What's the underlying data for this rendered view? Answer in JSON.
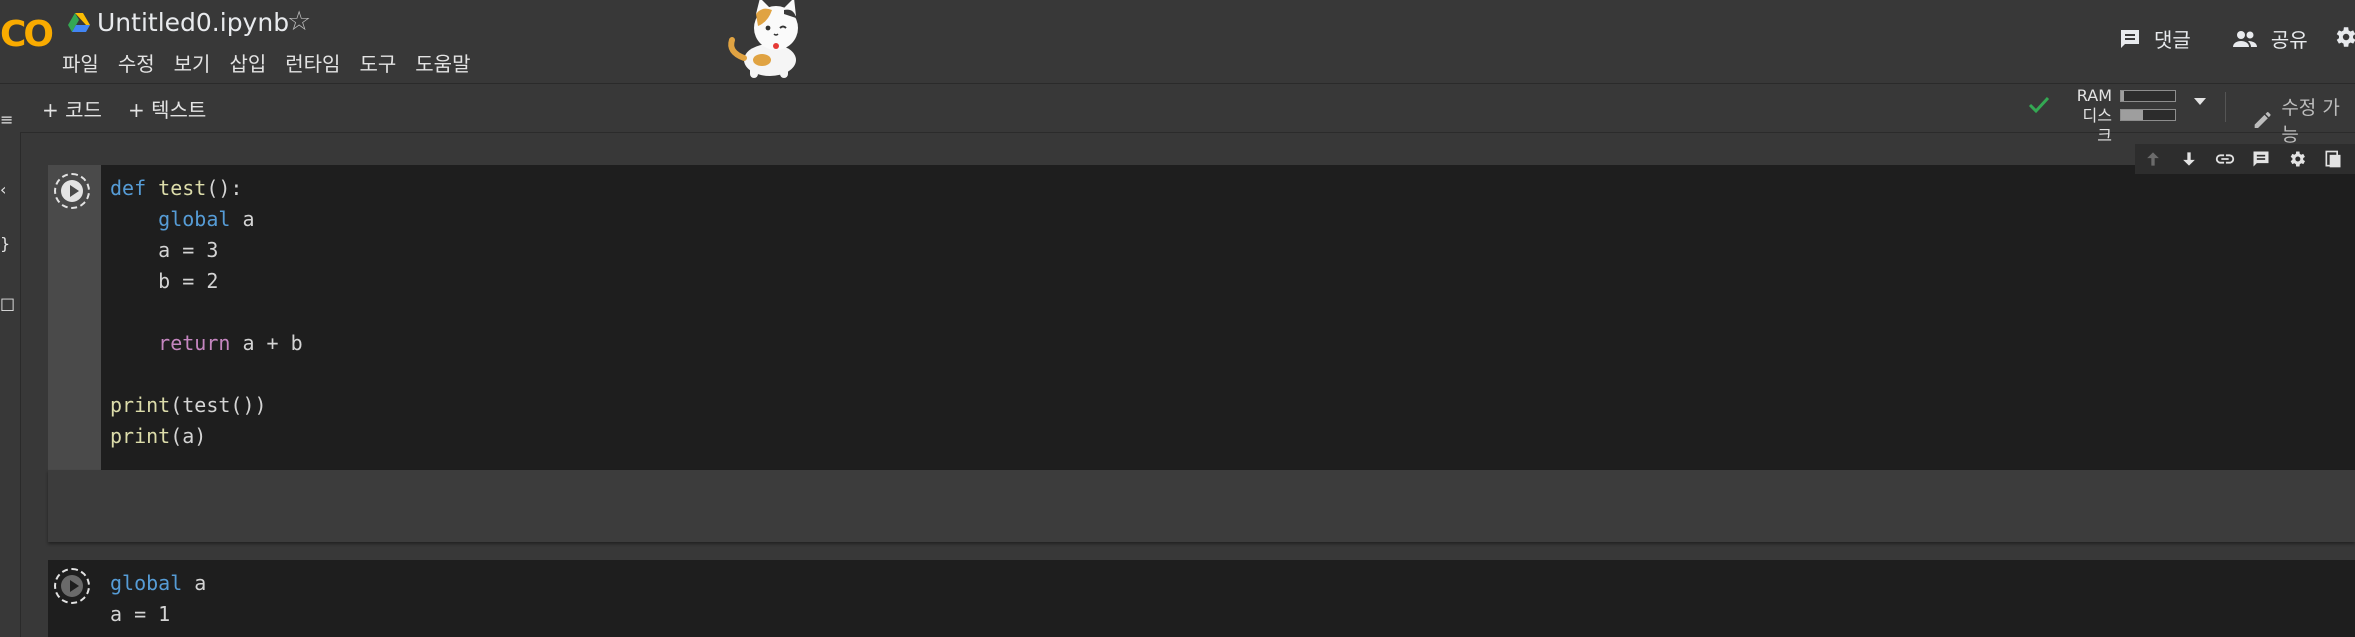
{
  "app": {
    "logo_text": "CO",
    "title": "Untitled0.ipynb",
    "menu": [
      "파일",
      "수정",
      "보기",
      "삽입",
      "런타임",
      "도구",
      "도움말"
    ]
  },
  "header_actions": {
    "comment_label": "댓글",
    "share_label": "공유"
  },
  "toolbar": {
    "add_code": "+ 코드",
    "add_text": "+ 텍스트",
    "ram_label": "RAM",
    "disk_label": "디스크",
    "ram_usage": 0.05,
    "disk_usage": 0.4,
    "edit_label": "수정 가능"
  },
  "cells": [
    {
      "lines": [
        [
          {
            "t": "def",
            "c": "kw"
          },
          {
            "t": " "
          },
          {
            "t": "test",
            "c": "fn"
          },
          {
            "t": "():"
          }
        ],
        [
          {
            "t": "    "
          },
          {
            "t": "global",
            "c": "kw"
          },
          {
            "t": " a"
          }
        ],
        [
          {
            "t": "    a = 3"
          }
        ],
        [
          {
            "t": "    b = 2"
          }
        ],
        [
          {
            "t": ""
          }
        ],
        [
          {
            "t": "    "
          },
          {
            "t": "return",
            "c": "kw2"
          },
          {
            "t": " a + b"
          }
        ],
        [
          {
            "t": ""
          }
        ],
        [
          {
            "t": "print",
            "c": "fn"
          },
          {
            "t": "(test())"
          }
        ],
        [
          {
            "t": "print",
            "c": "fn"
          },
          {
            "t": "(a)"
          }
        ]
      ]
    },
    {
      "lines": [
        [
          {
            "t": "global",
            "c": "kw"
          },
          {
            "t": " a"
          }
        ],
        [
          {
            "t": "a = 1"
          }
        ]
      ]
    }
  ],
  "icons": {
    "drive": "google-drive-icon",
    "star": "star-icon",
    "comment": "comment-icon",
    "share": "people-icon",
    "settings": "gear-icon",
    "check": "check-icon",
    "edit": "pencil-icon"
  }
}
